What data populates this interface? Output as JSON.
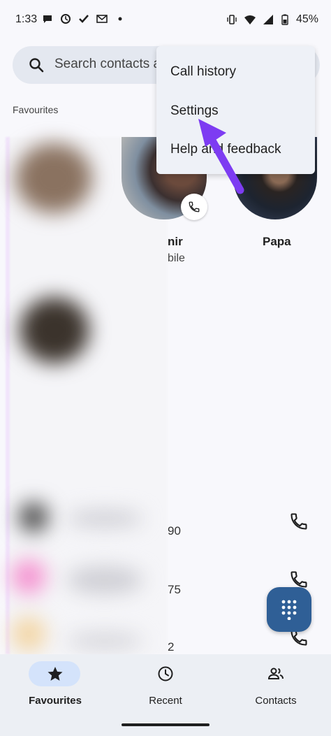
{
  "status_bar": {
    "time": "1:33",
    "battery": "45%",
    "icons_left": [
      "chat-icon",
      "recent-icon",
      "check-icon",
      "mail-icon",
      "dot-icon"
    ],
    "icons_right": [
      "vibrate-icon",
      "wifi-icon",
      "signal-icon",
      "battery-icon"
    ]
  },
  "search": {
    "placeholder": "Search contacts a"
  },
  "section": {
    "favourites_label": "Favourites"
  },
  "menu": {
    "items": [
      {
        "label": "Call history"
      },
      {
        "label": "Settings"
      },
      {
        "label": "Help and feedback"
      }
    ]
  },
  "favourites": [
    {
      "name": "nir",
      "sub": "bile"
    },
    {
      "name": "Papa",
      "sub": ""
    }
  ],
  "recent_rows": [
    {
      "number_fragment": "90"
    },
    {
      "number_fragment": "75"
    },
    {
      "number_fragment": "2"
    }
  ],
  "bottom_nav": {
    "items": [
      {
        "label": "Favourites",
        "icon": "star-icon",
        "selected": true
      },
      {
        "label": "Recent",
        "icon": "clock-icon",
        "selected": false
      },
      {
        "label": "Contacts",
        "icon": "people-icon",
        "selected": false
      }
    ]
  },
  "colors": {
    "accent_arrow": "#7d3cf2",
    "fab": "#2f5f96",
    "nav_pill": "#d4e3fb"
  }
}
